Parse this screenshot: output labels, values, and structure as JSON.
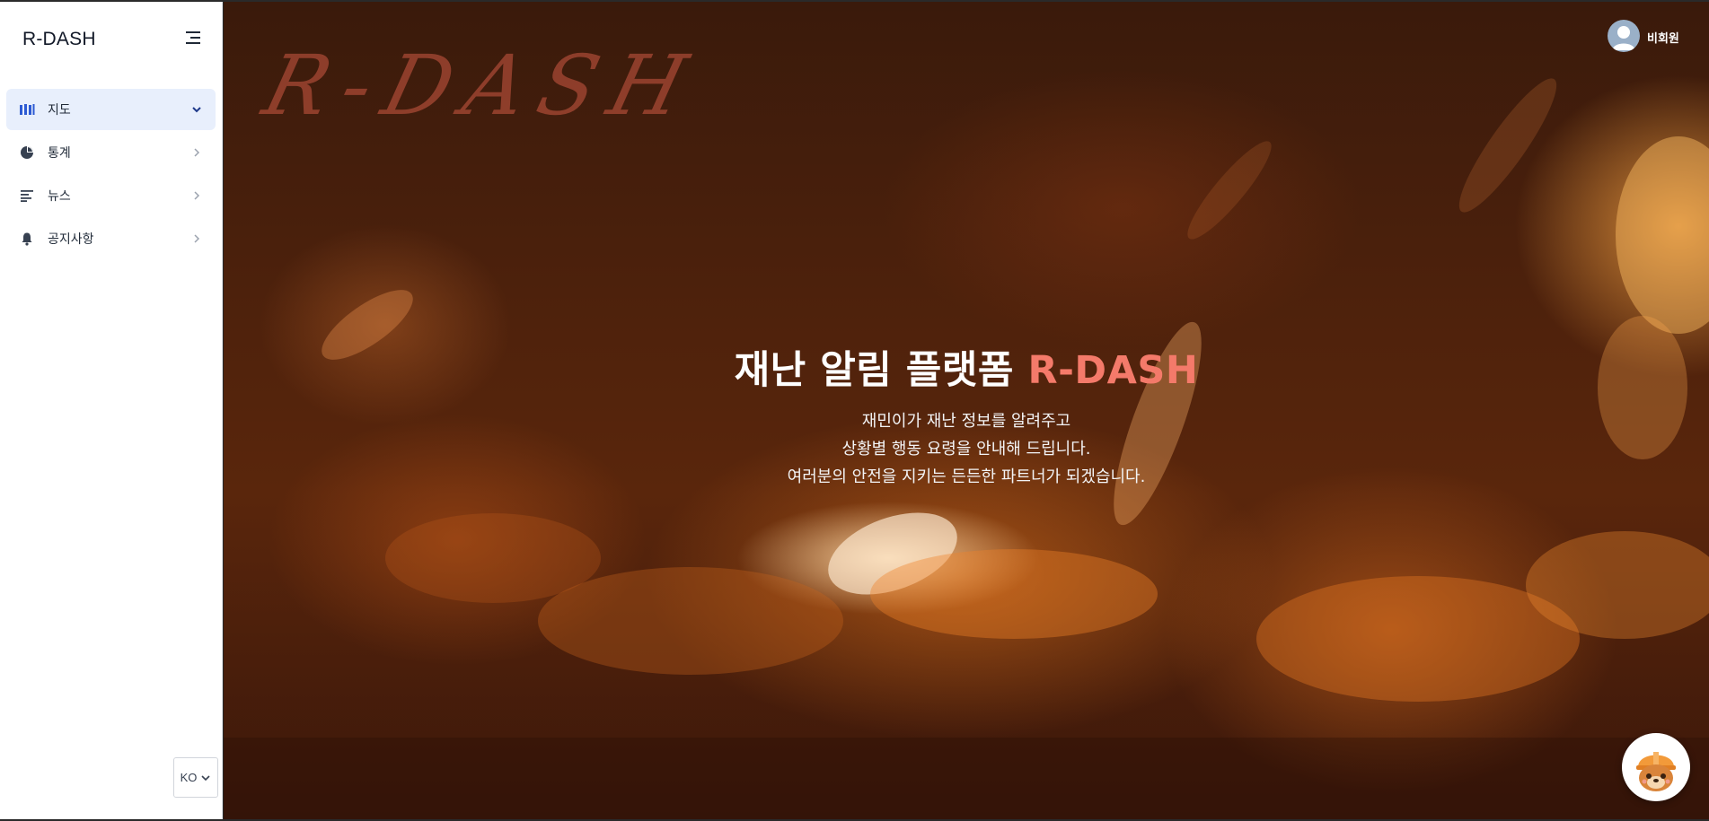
{
  "sidebar": {
    "brand": "R-DASH",
    "items": [
      {
        "label": "지도",
        "icon": "map-icon",
        "active": true
      },
      {
        "label": "통계",
        "icon": "pie-chart-icon",
        "active": false
      },
      {
        "label": "뉴스",
        "icon": "news-icon",
        "active": false
      },
      {
        "label": "공지사항",
        "icon": "bell-icon",
        "active": false
      }
    ],
    "language": {
      "selected": "KO"
    }
  },
  "header": {
    "user_name": "비회원"
  },
  "hero": {
    "logo_text": "R-DASH",
    "title_main": "재난 알림 플랫폼 ",
    "title_accent": "R-DASH",
    "subtitle_lines": [
      "재민이가 재난 정보를 알려주고",
      "상황별 행동 요령을 안내해 드립니다.",
      "여러분의 안전을 지키는 든든한 파트너가 되겠습니다."
    ]
  },
  "colors": {
    "accent": "#f47a6a",
    "active_nav_bg": "#e8effc",
    "active_icon": "#2d5bd3"
  }
}
